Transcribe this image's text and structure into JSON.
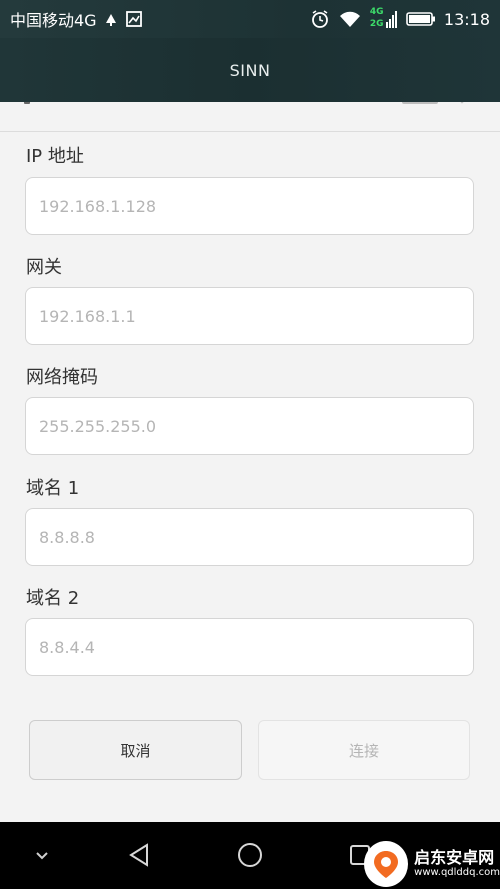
{
  "status_bar": {
    "carrier": "中国移动4G",
    "signal_4g": "4G",
    "signal_2g": "2G",
    "time": "13:18"
  },
  "header": {
    "title": "SINN"
  },
  "form": {
    "fields": [
      {
        "label": "IP 地址",
        "placeholder": "192.168.1.128",
        "value": ""
      },
      {
        "label": "网关",
        "placeholder": "192.168.1.1",
        "value": ""
      },
      {
        "label": "网络掩码",
        "placeholder": "255.255.255.0",
        "value": ""
      },
      {
        "label": "域名 1",
        "placeholder": "8.8.8.8",
        "value": ""
      },
      {
        "label": "域名 2",
        "placeholder": "8.8.4.4",
        "value": ""
      }
    ],
    "cancel_label": "取消",
    "connect_label": "连接"
  },
  "watermark": {
    "name": "启东安卓网",
    "url": "www.qdlddq.com"
  },
  "colors": {
    "header_bg": "#1f3538",
    "page_bg": "#f3f3f3",
    "input_border": "#d5d5d5",
    "placeholder": "#b5b5b5",
    "disabled_text": "#b5b5b5",
    "brand_orange": "#f26b21"
  }
}
